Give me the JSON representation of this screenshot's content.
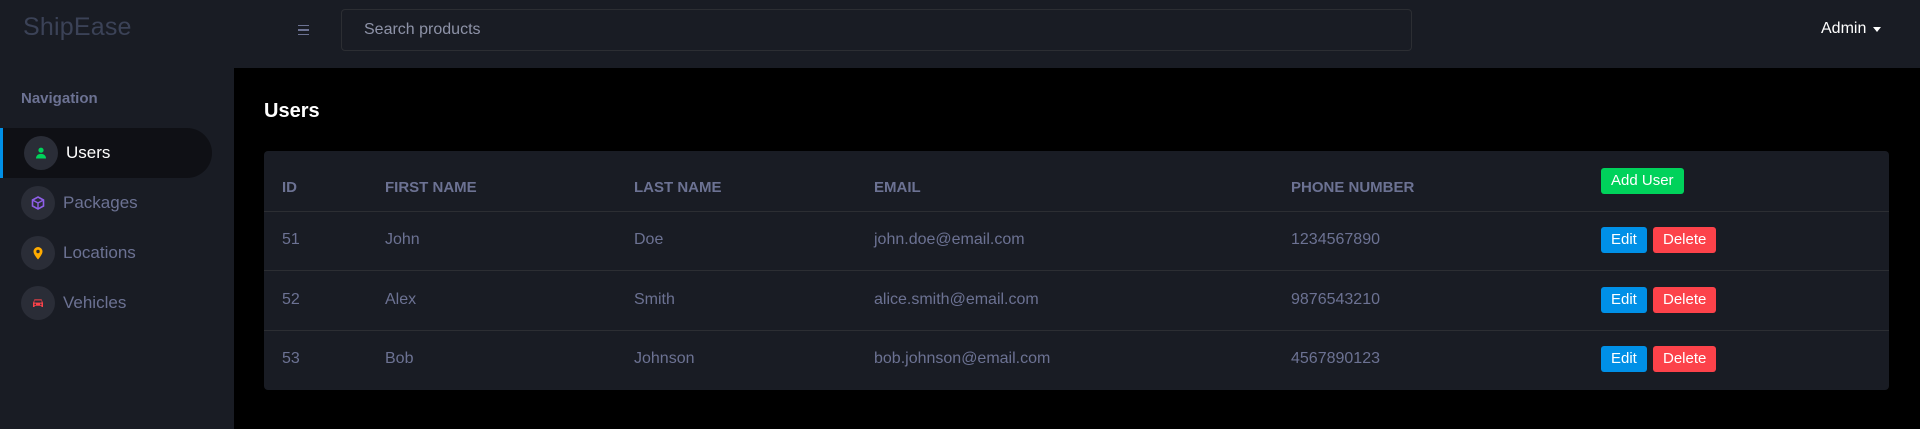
{
  "app": {
    "brand": "ShipEase"
  },
  "header": {
    "search_placeholder": "Search products",
    "user_label": "Admin"
  },
  "sidebar": {
    "heading": "Navigation",
    "items": [
      {
        "label": "Users",
        "icon": "user-icon",
        "icon_color": "#00d25b",
        "active": true
      },
      {
        "label": "Packages",
        "icon": "cube-icon",
        "icon_color": "#8f5fe8",
        "active": false
      },
      {
        "label": "Locations",
        "icon": "map-pin-icon",
        "icon_color": "#ffab00",
        "active": false
      },
      {
        "label": "Vehicles",
        "icon": "car-icon",
        "icon_color": "#fc424a",
        "active": false
      }
    ]
  },
  "main": {
    "title": "Users",
    "table": {
      "columns": [
        "ID",
        "FIRST NAME",
        "LAST NAME",
        "EMAIL",
        "PHONE NUMBER"
      ],
      "add_button": "Add User",
      "edit_button": "Edit",
      "delete_button": "Delete",
      "rows": [
        {
          "id": "51",
          "first_name": "John",
          "last_name": "Doe",
          "email": "john.doe@email.com",
          "phone": "1234567890"
        },
        {
          "id": "52",
          "first_name": "Alex",
          "last_name": "Smith",
          "email": "alice.smith@email.com",
          "phone": "9876543210"
        },
        {
          "id": "53",
          "first_name": "Bob",
          "last_name": "Johnson",
          "email": "bob.johnson@email.com",
          "phone": "4567890123"
        }
      ]
    }
  },
  "colors": {
    "accent_blue": "#0090e7",
    "success_green": "#00d25b",
    "danger_red": "#fc424a",
    "muted_text": "#6c7293",
    "panel_bg": "#191c24"
  }
}
